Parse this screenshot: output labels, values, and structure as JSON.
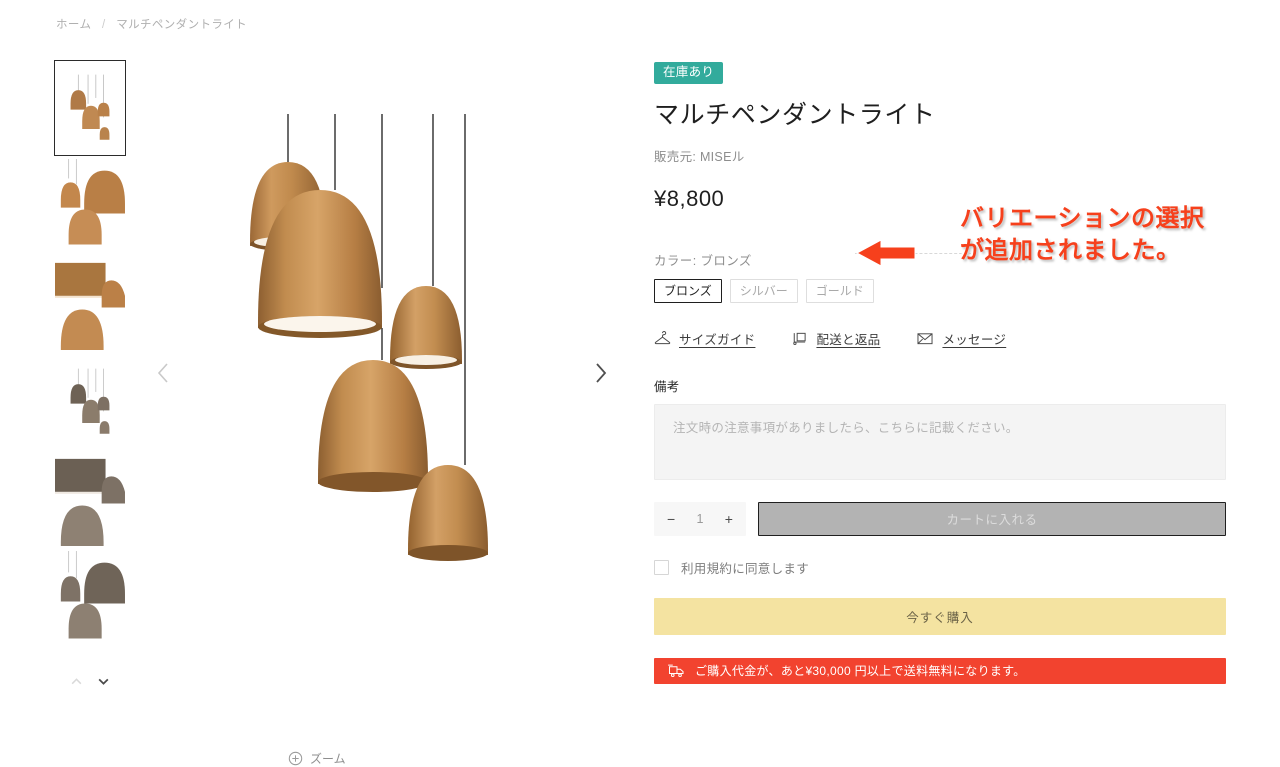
{
  "breadcrumb": {
    "home": "ホーム",
    "separator": "/",
    "current": "マルチペンダントライト"
  },
  "gallery": {
    "prev_label": "前の画像",
    "next_label": "次の画像",
    "zoom_label": "ズーム",
    "thumb_up_label": "上へ",
    "thumb_down_label": "下へ",
    "thumbnails": [
      {
        "alt": "マルチペンダントライト ブロンズ 全体",
        "selected": true
      },
      {
        "alt": "マルチペンダントライト 拡大 1",
        "selected": false
      },
      {
        "alt": "マルチペンダントライト 拡大 2",
        "selected": false
      },
      {
        "alt": "マルチペンダントライト シルバー 全体",
        "selected": false
      },
      {
        "alt": "マルチペンダントライト シルバー 拡大 1",
        "selected": false
      },
      {
        "alt": "マルチペンダントライト シルバー 拡大 2",
        "selected": false
      }
    ]
  },
  "product": {
    "stock_badge": "在庫あり",
    "title": "マルチペンダントライト",
    "vendor": "販売元: MISEル",
    "price": "¥8,800"
  },
  "variant": {
    "label": "カラー: ブロンズ",
    "options": [
      {
        "label": "ブロンズ",
        "selected": true
      },
      {
        "label": "シルバー",
        "selected": false
      },
      {
        "label": "ゴールド",
        "selected": false
      }
    ]
  },
  "links": [
    {
      "label": "サイズガイド",
      "icon": "hanger-icon"
    },
    {
      "label": "配送と返品",
      "icon": "delivery-box-icon"
    },
    {
      "label": "メッセージ",
      "icon": "envelope-icon"
    }
  ],
  "note": {
    "label": "備考",
    "placeholder": "注文時の注意事項がありましたら、こちらに記載ください。"
  },
  "purchase": {
    "qty_minus": "−",
    "qty_value": "1",
    "qty_plus": "+",
    "add_to_cart": "カートに入れる",
    "agree_label": "利用規約に同意します",
    "buy_now": "今すぐ購入"
  },
  "shipping_notice": {
    "text": "ご購入代金が、あと¥30,000 円以上で送料無料になります。",
    "icon": "truck-icon",
    "background": "#f2432f"
  },
  "annotation": {
    "line1": "バリエーションの選択",
    "line2": "が追加されました。",
    "color": "#f6401c",
    "arrow": "left-arrow-icon"
  },
  "colors": {
    "badge": "#32ab9c",
    "buy_now": "#f4e3a1",
    "cart_disabled": "#b3b3b3",
    "notice": "#f2432f",
    "annotation": "#f6401c"
  }
}
